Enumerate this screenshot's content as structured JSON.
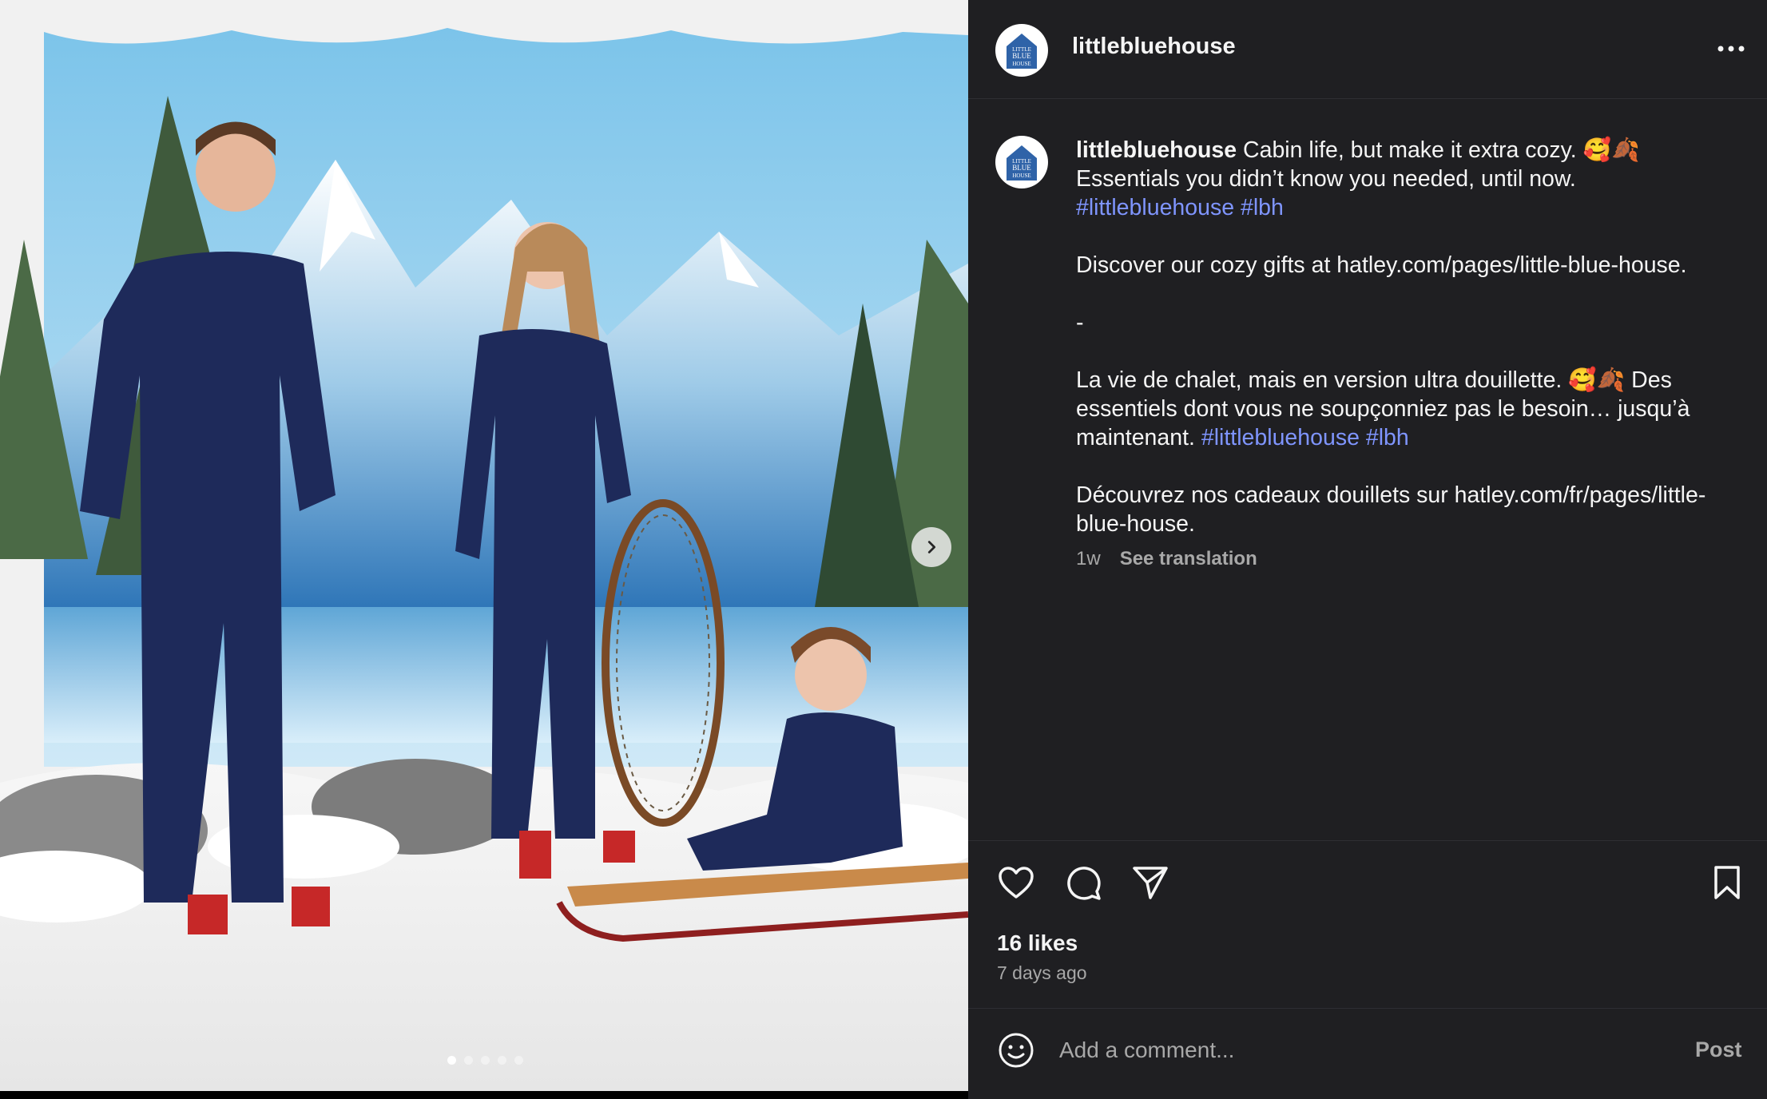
{
  "post": {
    "username": "littlebluehouse",
    "avatar_text": [
      "LITTLE",
      "BLUE",
      "HOUSE"
    ],
    "caption": {
      "username": "littlebluehouse",
      "line1": " Cabin life, but make it extra cozy. 🥰🍂",
      "line2": "Essentials you didn’t know you needed, until now.",
      "tag1": "#littlebluehouse",
      "tag2": "#lbh",
      "discover_en": "Discover our cozy gifts at hatley.com/pages/little-blue-house.",
      "dash": "-",
      "fr_line1": "La vie de chalet, mais en version ultra douillette. 🥰🍂 Des essentiels dont vous ne soupçonniez pas le besoin… jusqu’à maintenant. ",
      "fr_tag1": "#littlebluehouse",
      "fr_tag2": "#lbh",
      "discover_fr": "Découvrez nos cadeaux douillets sur hatley.com/fr/pages/little-blue-house."
    },
    "time_short": "1w",
    "see_translation": "See translation",
    "likes": "16 likes",
    "time_ago": "7 days ago",
    "comment_placeholder": "Add a comment...",
    "post_button": "Post",
    "carousel": {
      "total": 5,
      "active": 1
    },
    "colors": {
      "panel_bg": "#1f1f22",
      "link": "#7f95ff",
      "muted": "#a8a8a8"
    }
  }
}
